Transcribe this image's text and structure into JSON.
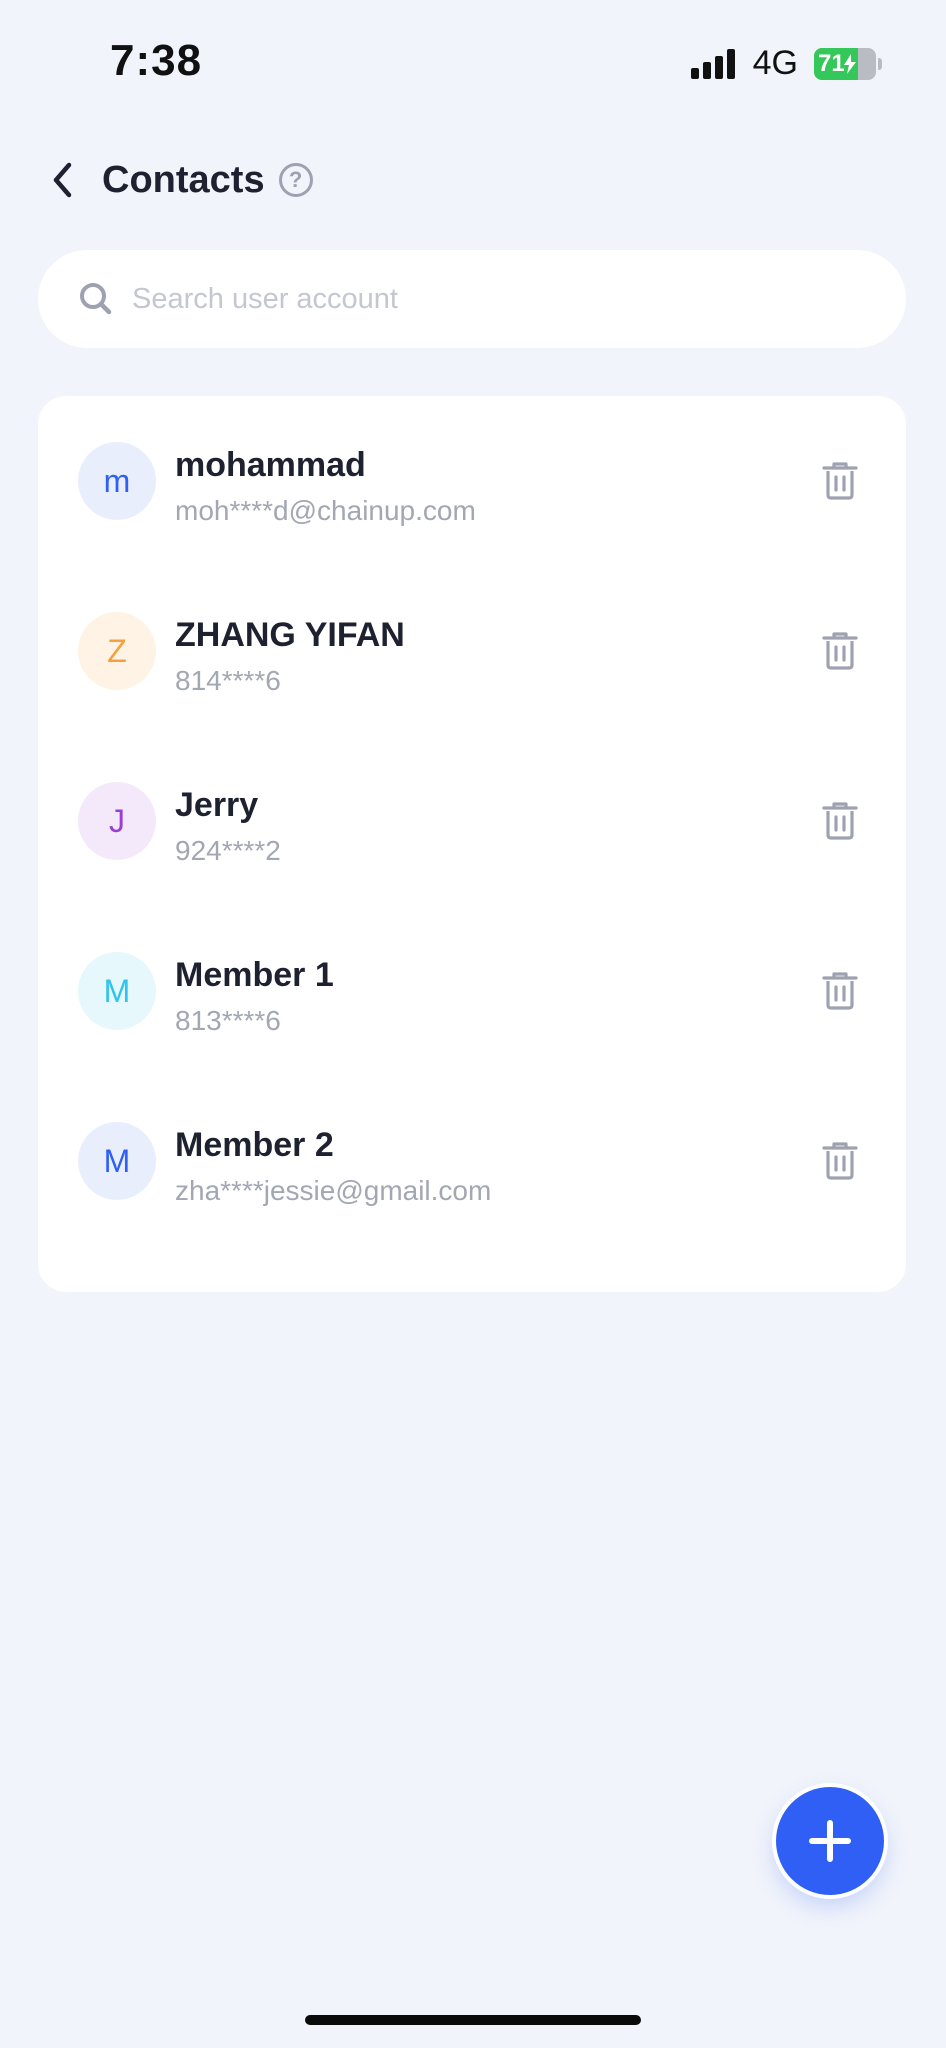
{
  "status_bar": {
    "time": "7:38",
    "network": "4G",
    "battery_label": "71",
    "battery_level": 0.71
  },
  "header": {
    "title": "Contacts",
    "help_label": "?"
  },
  "search": {
    "placeholder": "Search user account"
  },
  "contacts": [
    {
      "initial": "m",
      "name": "mohammad",
      "account": "moh****d@chainup.com",
      "avatar_bg": "#e9eefc",
      "avatar_fg": "#2f5ff5"
    },
    {
      "initial": "Z",
      "name": "ZHANG YIFAN",
      "account": "814****6",
      "avatar_bg": "#fff3e6",
      "avatar_fg": "#f5a03c"
    },
    {
      "initial": "J",
      "name": "Jerry",
      "account": "924****2",
      "avatar_bg": "#f3e9fb",
      "avatar_fg": "#9b3fd4"
    },
    {
      "initial": "M",
      "name": "Member 1",
      "account": "813****6",
      "avatar_bg": "#e6f8fc",
      "avatar_fg": "#2ec4ee"
    },
    {
      "initial": "M",
      "name": "Member 2",
      "account": "zha****jessie@gmail.com",
      "avatar_bg": "#e9eefc",
      "avatar_fg": "#2f5ff5"
    }
  ],
  "colors": {
    "accent": "#2f5ff5",
    "background": "#f1f4fb",
    "icon_gray": "#9ea2b0"
  }
}
